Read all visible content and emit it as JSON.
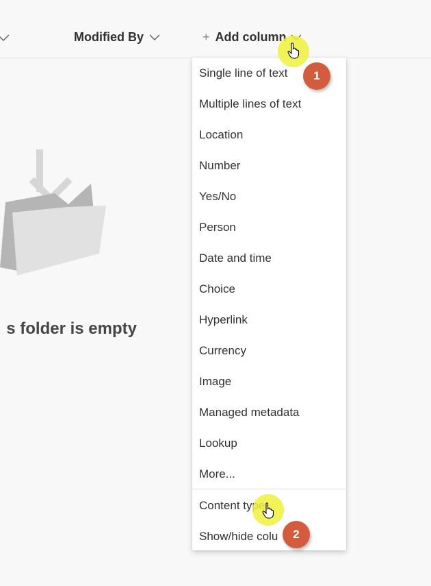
{
  "header": {
    "columns": [
      {
        "label": "Modified By"
      },
      {
        "label": "Add column"
      }
    ]
  },
  "empty_state": {
    "message": "s folder is empty"
  },
  "menu": {
    "items": [
      {
        "label": "Single line of text"
      },
      {
        "label": "Multiple lines of text"
      },
      {
        "label": "Location"
      },
      {
        "label": "Number"
      },
      {
        "label": "Yes/No"
      },
      {
        "label": "Person"
      },
      {
        "label": "Date and time"
      },
      {
        "label": "Choice"
      },
      {
        "label": "Hyperlink"
      },
      {
        "label": "Currency"
      },
      {
        "label": "Image"
      },
      {
        "label": "Managed metadata"
      },
      {
        "label": "Lookup"
      },
      {
        "label": "More..."
      },
      {
        "label": "Content type"
      },
      {
        "label": "Show/hide colu"
      }
    ]
  },
  "annotations": [
    {
      "number": "1"
    },
    {
      "number": "2"
    }
  ],
  "colors": {
    "background": "#f8f8f8",
    "menu_background": "#ffffff",
    "badge": "#d35c3f",
    "cursor_highlight": "#f0f03c"
  }
}
